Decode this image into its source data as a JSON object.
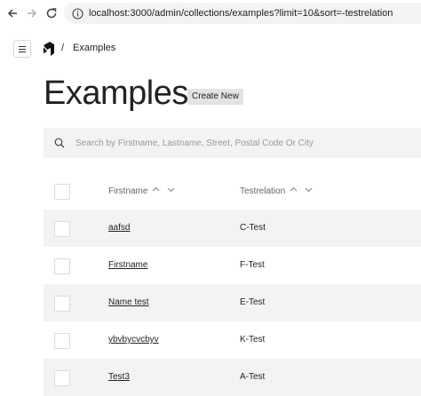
{
  "browser": {
    "url": "localhost:3000/admin/collections/examples?limit=10&sort=-testrelation"
  },
  "header": {
    "breadcrumb_separator": "/",
    "breadcrumb_current": "Examples"
  },
  "page": {
    "title": "Examples",
    "create_label": "Create New"
  },
  "search": {
    "placeholder": "Search by Firstname, Lastname, Street, Postal Code Or City",
    "value": ""
  },
  "table": {
    "columns": [
      "Firstname",
      "Testrelation"
    ],
    "rows": [
      {
        "firstname": "aafsd",
        "testrelation": "C-Test"
      },
      {
        "firstname": "Firstname",
        "testrelation": "F-Test"
      },
      {
        "firstname": "Name test",
        "testrelation": "E-Test"
      },
      {
        "firstname": "ybvbycvcbyv",
        "testrelation": "K-Test"
      },
      {
        "firstname": "Test3",
        "testrelation": "A-Test"
      }
    ]
  },
  "colors": {
    "row_alt": "#f3f3f3",
    "text": "#222222",
    "muted": "#666666"
  },
  "icons": [
    "back-arrow-icon",
    "forward-arrow-icon",
    "reload-icon",
    "info-icon",
    "menu-icon",
    "logo-icon",
    "search-icon",
    "sort-up-icon",
    "sort-down-icon"
  ]
}
